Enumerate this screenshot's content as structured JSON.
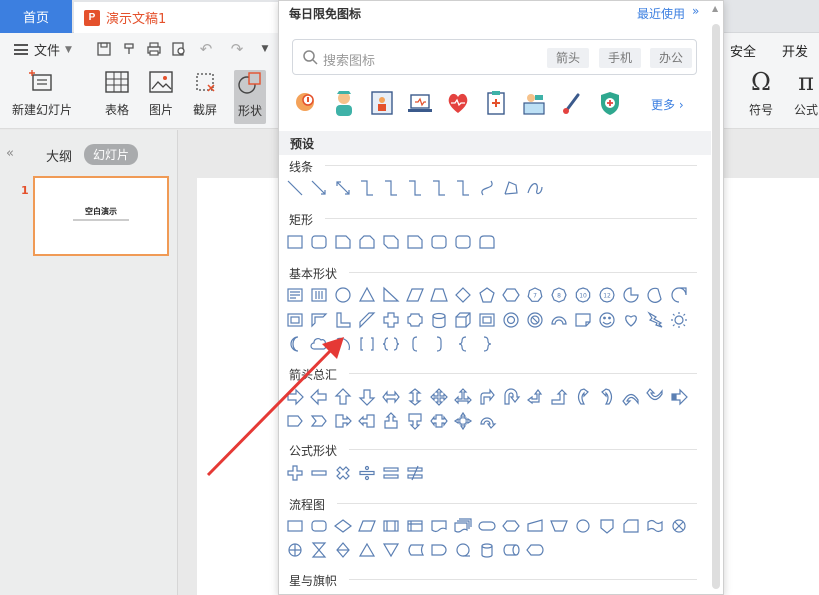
{
  "tabs": {
    "home": "首页",
    "doc": "演示文稿1",
    "doc_icon": "P"
  },
  "menu": {
    "file": "文件",
    "security": "安全",
    "dev": "开发工"
  },
  "ribbon": {
    "new_slide": "新建幻灯片",
    "table": "表格",
    "picture": "图片",
    "screenshot": "截屏",
    "shape": "形状",
    "symbol": "符号",
    "formula": "公式"
  },
  "left_panel": {
    "tab_outline": "大纲",
    "tab_slides": "幻灯片",
    "slide_number": "1",
    "slide_title": "空白演示"
  },
  "shape_panel": {
    "header": "每日限免图标",
    "recent": "最近使用",
    "search_placeholder": "搜索图标",
    "search_tags": [
      "箭头",
      "手机",
      "办公"
    ],
    "more": "更多",
    "featured_icons": [
      "brain-icon",
      "nurse-icon",
      "hospital-room-icon",
      "laptop-medical-icon",
      "heart-health-icon",
      "clipboard-medical-icon",
      "injury-icon",
      "thermometer-icon",
      "shield-cross-icon"
    ],
    "preset_label": "预设",
    "categories": {
      "lines": "线条",
      "rect": "矩形",
      "basic": "基本形状",
      "arrows": "箭头总汇",
      "formula": "公式形状",
      "flowchart": "流程图",
      "stars": "星与旗帜"
    }
  },
  "colors": {
    "accent_blue": "#3c7fe0",
    "wps_orange": "#e4512c",
    "shape_stroke": "#5b7fb3",
    "annotation_arrow": "#e53935"
  }
}
